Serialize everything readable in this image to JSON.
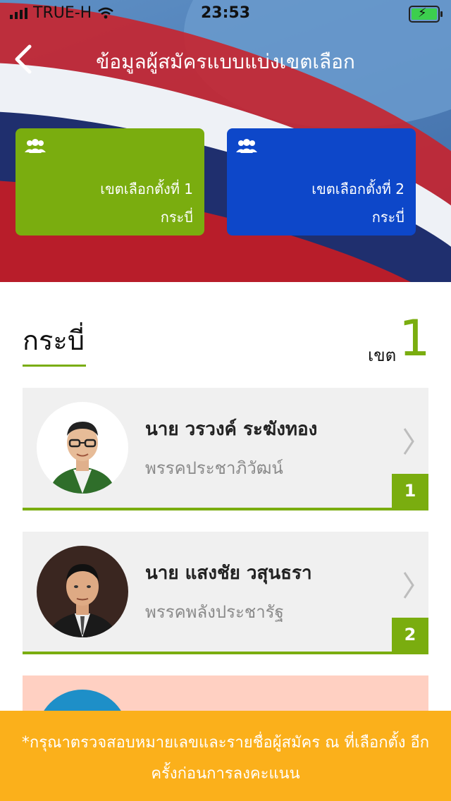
{
  "status_bar": {
    "carrier": "TRUE-H",
    "time": "23:53"
  },
  "header": {
    "title": "ข้อมูลผู้สมัครแบบแบ่งเขตเลือก"
  },
  "zone_cards": [
    {
      "zone_label": "เขตเลือกตั้งที่ 1",
      "province": "กระบี่",
      "color": "#7aad0f"
    },
    {
      "zone_label": "เขตเลือกตั้งที่ 2",
      "province": "กระบี่",
      "color": "#0d47c9"
    }
  ],
  "section": {
    "province": "กระบี่",
    "zone_word": "เขต",
    "zone_number": "1"
  },
  "candidates": [
    {
      "name": "นาย วรวงค์ ระฆังทอง",
      "party": "พรรคประชาภิวัฒน์",
      "number": "1"
    },
    {
      "name": "นาย แสงชัย วสุนธรา",
      "party": "พรรคพลังประชารัฐ",
      "number": "2"
    }
  ],
  "notice": "*กรุณาตรวจสอบหมายเลขและรายชื่อผู้สมัคร ณ ที่เลือกตั้ง อีกครั้งก่อนการลงคะแนน",
  "colors": {
    "accent_green": "#7aad0f",
    "accent_blue": "#0d47c9",
    "notice_orange": "#fbb01b"
  }
}
